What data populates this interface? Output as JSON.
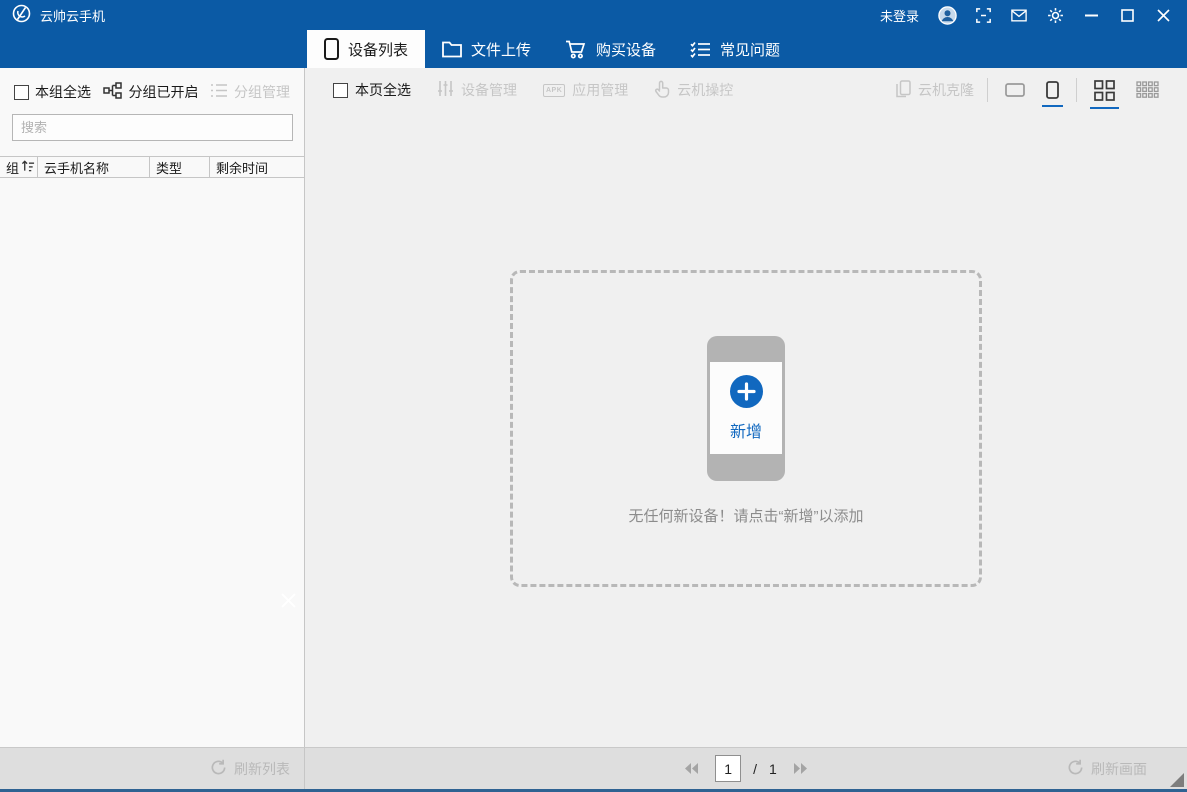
{
  "colors": {
    "titlebar_blue": "#0b5aa5",
    "accent_blue": "#1168bf",
    "disabled_gray": "#c6c6c6",
    "bottom_border_blue": "#2f6292"
  },
  "titlebar": {
    "app_title": "云帅云手机",
    "login_status": "未登录"
  },
  "tabs": [
    {
      "label": "设备列表",
      "active": true
    },
    {
      "label": "文件上传",
      "active": false
    },
    {
      "label": "购买设备",
      "active": false
    },
    {
      "label": "常见问题",
      "active": false
    }
  ],
  "sidebar": {
    "select_all_group_label": "本组全选",
    "grouping_enabled_label": "分组已开启",
    "group_manage_label": "分组管理",
    "search_placeholder": "搜索",
    "table_headers": [
      "组",
      "云手机名称",
      "类型",
      "剩余时间"
    ]
  },
  "toolbar": {
    "select_all_page_label": "本页全选",
    "device_manage_label": "设备管理",
    "app_manage_label": "应用管理",
    "apk_icon_text": "APK",
    "cloud_control_label": "云机操控",
    "cloud_clone_label": "云机克隆"
  },
  "empty_state": {
    "add_label": "新增",
    "message": "无任何新设备！请点击“新增”以添加"
  },
  "footer": {
    "refresh_list_label": "刷新列表",
    "refresh_screen_label": "刷新画面",
    "pagination": {
      "current_page": "1",
      "separator": "/",
      "total_pages": "1"
    }
  }
}
